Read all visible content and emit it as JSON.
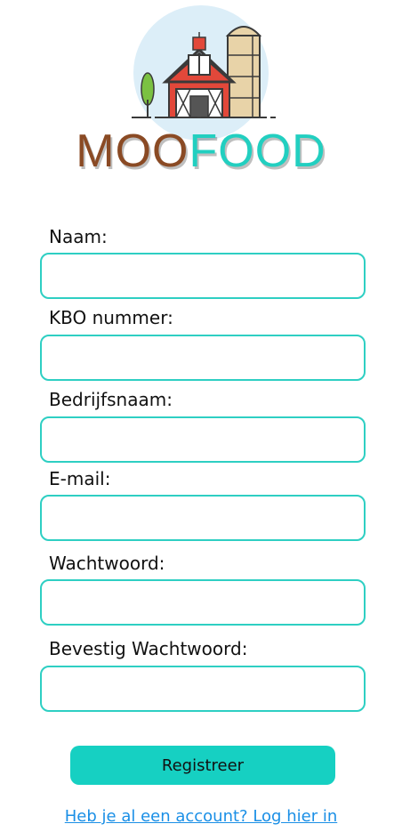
{
  "brand": {
    "part1": "MOO",
    "part2": "FOOD"
  },
  "form": {
    "fields": [
      {
        "label": "Naam:",
        "value": ""
      },
      {
        "label": "KBO nummer:",
        "value": ""
      },
      {
        "label": "Bedrijfsnaam:",
        "value": ""
      },
      {
        "label": "E-mail:",
        "value": ""
      },
      {
        "label": "Wachtwoord:",
        "value": ""
      },
      {
        "label": "Bevestig Wachtwoord:",
        "value": ""
      }
    ],
    "submit_label": "Registreer",
    "login_link": "Heb je al een account? Log hier in"
  },
  "colors": {
    "accent": "#16d0c2",
    "border": "#2ecfc3",
    "link": "#1a8fe6",
    "brand_brown": "#8a4a24"
  }
}
